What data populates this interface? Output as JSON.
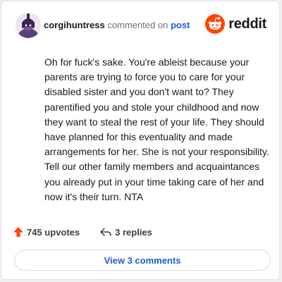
{
  "header": {
    "username": "corgihuntress",
    "action_text": "commented on",
    "post_link": "post",
    "logo_text": "reddit"
  },
  "comment": {
    "text": "Oh for fuck's sake. You're ableist because your parents are trying to force you to care for your disabled sister and you don't want to? They parentified you and stole your childhood and now they want to steal the rest of your life. They should have planned for this eventuality and made arrangements for her. She is not your responsibility. Tell our other family members and acquaintances you already put in your time taking care of her and now it's their turn. NTA"
  },
  "actions": {
    "upvotes": "745 upvotes",
    "replies": "3 replies"
  },
  "footer": {
    "view_comments": "View 3 comments"
  },
  "colors": {
    "accent_blue": "#1e5bd6",
    "reddit_orange": "#ff4500",
    "upvote_orange": "#ff4500"
  },
  "icons": {
    "avatar": "snoo-avatar",
    "logo": "reddit-logo-icon",
    "upvote": "upvote-arrow-icon",
    "reply": "reply-arrow-icon"
  }
}
